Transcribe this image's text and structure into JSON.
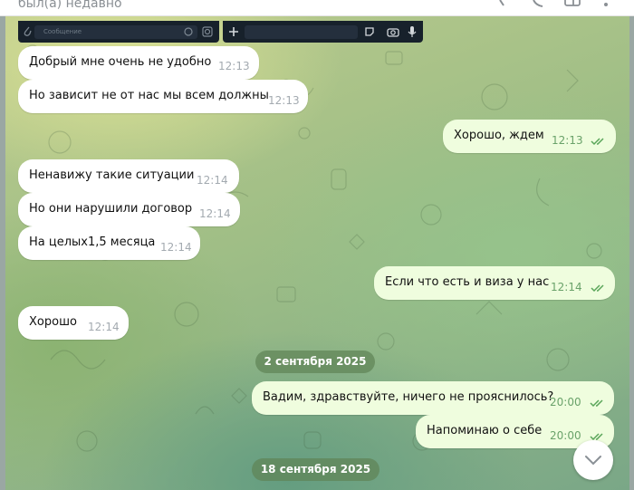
{
  "header": {
    "status": "был(а) недавно"
  },
  "preview": {
    "left_placeholder": "Сообщение"
  },
  "messages": [
    {
      "dir": "in",
      "text": "Добрый мне очень не удобно",
      "time": "12:13"
    },
    {
      "dir": "in",
      "text": "Но зависит не от нас мы всем должны",
      "time": "12:13"
    },
    {
      "dir": "out",
      "text": "Хорошо, ждем",
      "time": "12:13",
      "read": true
    },
    {
      "dir": "in",
      "text": "Ненавижу такие ситуации",
      "time": "12:14"
    },
    {
      "dir": "in",
      "text": "Но они нарушили договор",
      "time": "12:14"
    },
    {
      "dir": "in",
      "text": "На целых1,5 месяца",
      "time": "12:14"
    },
    {
      "dir": "out",
      "text": "Если что есть и виза у нас",
      "time": "12:14",
      "read": true
    },
    {
      "dir": "in",
      "text": "Хорошо",
      "time": "12:14"
    },
    {
      "dir": "out",
      "text": "Вадим, здравствуйте, ничего не прояснилось?",
      "time": "20:00",
      "read": true
    },
    {
      "dir": "out",
      "text": "Напоминаю о себе",
      "time": "20:00",
      "read": true
    }
  ],
  "dates": [
    "2 сентября 2025",
    "18 сентября 2025"
  ],
  "colors": {
    "incoming_bubble": "#ffffff",
    "outgoing_bubble": "#effdde",
    "read_check": "#5aa65a",
    "date_pill": "#608456"
  },
  "icons": [
    "search-icon",
    "phone-icon",
    "sidebar-icon",
    "more-icon",
    "attach-icon",
    "emoji-icon",
    "sticker-icon",
    "plus-icon",
    "camera-icon",
    "microphone-icon",
    "double-check-icon",
    "chevron-down-icon"
  ]
}
